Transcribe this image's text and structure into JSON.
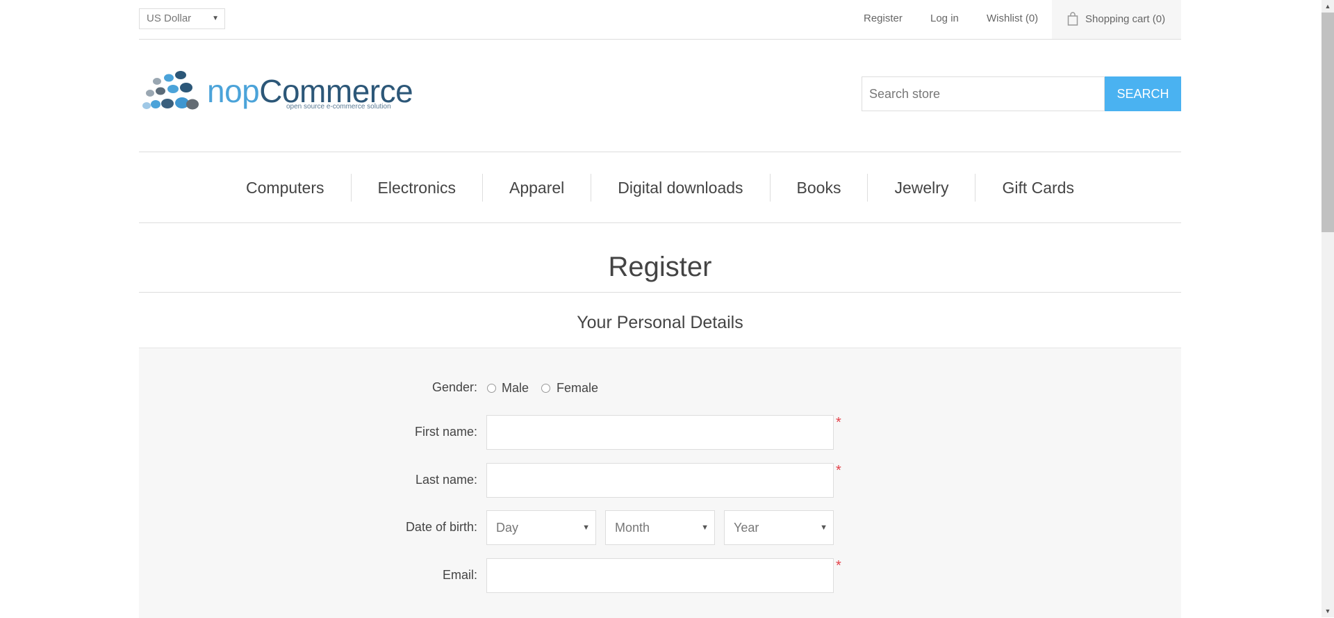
{
  "header": {
    "currency": "US Dollar",
    "links": {
      "register": "Register",
      "login": "Log in",
      "wishlist": "Wishlist (0)",
      "cart": "Shopping cart (0)"
    }
  },
  "logo": {
    "brand_prefix": "nop",
    "brand_suffix": "Commerce",
    "tagline": "open source e-commerce solution"
  },
  "search": {
    "placeholder": "Search store",
    "button": "SEARCH"
  },
  "nav": [
    "Computers",
    "Electronics",
    "Apparel",
    "Digital downloads",
    "Books",
    "Jewelry",
    "Gift Cards"
  ],
  "page": {
    "title": "Register",
    "section": "Your Personal Details"
  },
  "form": {
    "gender_label": "Gender:",
    "gender_male": "Male",
    "gender_female": "Female",
    "first_name_label": "First name:",
    "last_name_label": "Last name:",
    "dob_label": "Date of birth:",
    "dob_day": "Day",
    "dob_month": "Month",
    "dob_year": "Year",
    "email_label": "Email:",
    "required_mark": "*"
  },
  "colors": {
    "accent": "#4ab2f1",
    "required": "#e4434b"
  }
}
